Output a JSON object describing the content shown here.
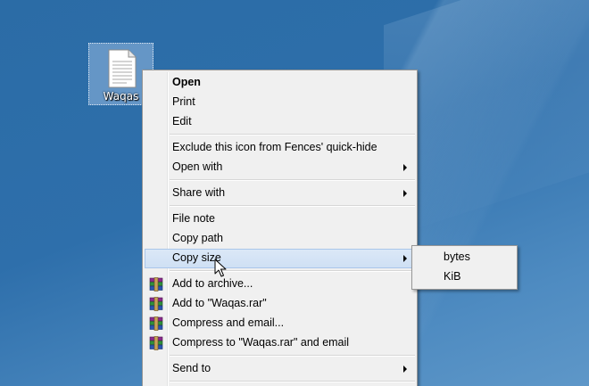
{
  "desktop": {
    "icon": {
      "label": "Waqas",
      "icon_name": "text-file-icon"
    }
  },
  "context_menu": {
    "items": [
      {
        "label": "Open",
        "bold": true,
        "has_submenu": false
      },
      {
        "label": "Print",
        "has_submenu": false
      },
      {
        "label": "Edit",
        "has_submenu": false
      },
      {
        "label": "Exclude this icon from Fences' quick-hide",
        "has_submenu": false
      },
      {
        "label": "Open with",
        "has_submenu": true
      },
      {
        "label": "Share with",
        "has_submenu": true
      },
      {
        "label": "File note",
        "has_submenu": false
      },
      {
        "label": "Copy path",
        "has_submenu": false
      },
      {
        "label": "Copy size",
        "has_submenu": true,
        "highlighted": true
      },
      {
        "label": "Add to archive...",
        "icon": "winrar-icon"
      },
      {
        "label": "Add to \"Waqas.rar\"",
        "icon": "winrar-icon"
      },
      {
        "label": "Compress and email...",
        "icon": "winrar-icon"
      },
      {
        "label": "Compress to \"Waqas.rar\" and email",
        "icon": "winrar-icon"
      },
      {
        "label": "Send to",
        "has_submenu": true
      }
    ]
  },
  "submenu": {
    "parent": "Copy size",
    "items": [
      {
        "label": "bytes"
      },
      {
        "label": "KiB"
      }
    ]
  },
  "colors": {
    "desktop_bg": "#2e6fab",
    "menu_bg": "#f0f0f0",
    "highlight": "#cfe0f4",
    "highlight_border": "#a9c6ea"
  }
}
